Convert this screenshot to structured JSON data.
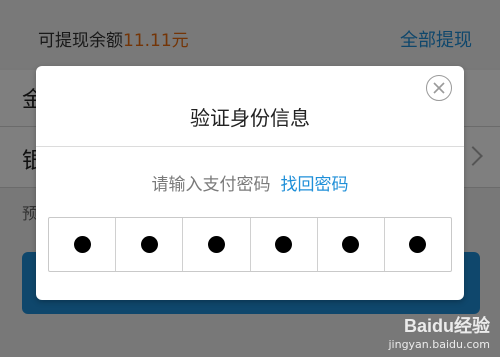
{
  "background": {
    "available_label": "可提现余额",
    "available_amount": "11.11元",
    "withdraw_all": "全部提现",
    "row2_text": "金",
    "row3_text": "银",
    "hint_text": "预"
  },
  "modal": {
    "title": "验证身份信息",
    "prompt": "请输入支付密码",
    "forgot_password": "找回密码",
    "pin_length": 6,
    "pin_filled": 6
  },
  "watermark": {
    "logo": "Baidu经验",
    "url": "jingyan.baidu.com"
  },
  "colors": {
    "accent": "#1f8fd8",
    "amount": "#e86b0e"
  }
}
